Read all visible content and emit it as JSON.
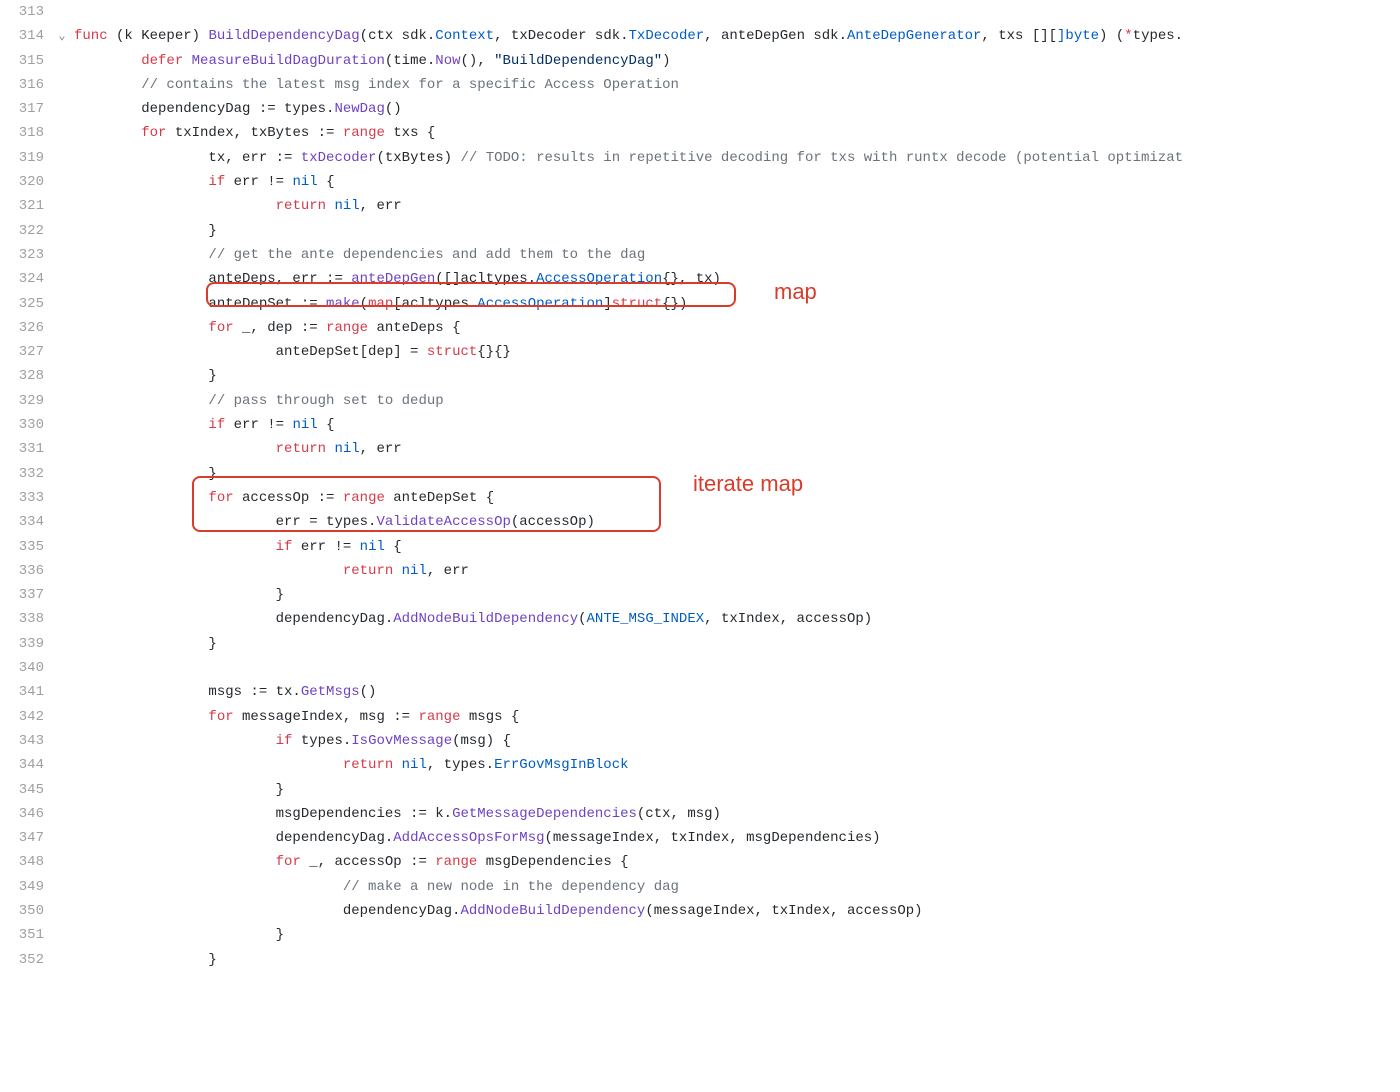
{
  "colors": {
    "keyword": "#d73a49",
    "function": "#6f42c1",
    "type": "#005cc5",
    "string": "#032f62",
    "comment": "#6a737d"
  },
  "annotations": {
    "box1_label": "map",
    "box2_label": "iterate map"
  },
  "lines": [
    {
      "ln": "313",
      "fold": "",
      "tokens": []
    },
    {
      "ln": "314",
      "fold": "⌄",
      "tokens": [
        [
          "kw",
          "func "
        ],
        [
          "id",
          "(k Keeper) "
        ],
        [
          "fn",
          "BuildDependencyDag"
        ],
        [
          "id",
          "(ctx sdk."
        ],
        [
          "ty",
          "Context"
        ],
        [
          "id",
          ", txDecoder sdk."
        ],
        [
          "ty",
          "TxDecoder"
        ],
        [
          "id",
          ", anteDepGen sdk."
        ],
        [
          "ty",
          "AnteDepGenerator"
        ],
        [
          "id",
          ", txs []["
        ],
        [
          "ty",
          "]byte"
        ],
        [
          "id",
          ") ("
        ],
        [
          "kw",
          "*"
        ],
        [
          "id",
          "types."
        ]
      ]
    },
    {
      "ln": "315",
      "fold": "",
      "tokens": [
        [
          "id",
          "        "
        ],
        [
          "kw",
          "defer "
        ],
        [
          "fn",
          "MeasureBuildDagDuration"
        ],
        [
          "id",
          "(time."
        ],
        [
          "fn",
          "Now"
        ],
        [
          "id",
          "(), "
        ],
        [
          "st",
          "\"BuildDependencyDag\""
        ],
        [
          "id",
          ")"
        ]
      ]
    },
    {
      "ln": "316",
      "fold": "",
      "tokens": [
        [
          "id",
          "        "
        ],
        [
          "cm",
          "// contains the latest msg index for a specific Access Operation"
        ]
      ]
    },
    {
      "ln": "317",
      "fold": "",
      "tokens": [
        [
          "id",
          "        dependencyDag := types."
        ],
        [
          "fn",
          "NewDag"
        ],
        [
          "id",
          "()"
        ]
      ]
    },
    {
      "ln": "318",
      "fold": "",
      "tokens": [
        [
          "id",
          "        "
        ],
        [
          "kw",
          "for "
        ],
        [
          "id",
          "txIndex, txBytes := "
        ],
        [
          "kw",
          "range "
        ],
        [
          "id",
          "txs {"
        ]
      ]
    },
    {
      "ln": "319",
      "fold": "",
      "tokens": [
        [
          "id",
          "                tx, err := "
        ],
        [
          "fn",
          "txDecoder"
        ],
        [
          "id",
          "(txBytes) "
        ],
        [
          "cm",
          "// TODO: results in repetitive decoding for txs with runtx decode (potential optimizat"
        ]
      ]
    },
    {
      "ln": "320",
      "fold": "",
      "tokens": [
        [
          "id",
          "                "
        ],
        [
          "kw",
          "if "
        ],
        [
          "id",
          "err != "
        ],
        [
          "ty",
          "nil"
        ],
        [
          "id",
          " {"
        ]
      ]
    },
    {
      "ln": "321",
      "fold": "",
      "tokens": [
        [
          "id",
          "                        "
        ],
        [
          "kw",
          "return "
        ],
        [
          "ty",
          "nil"
        ],
        [
          "id",
          ", err"
        ]
      ]
    },
    {
      "ln": "322",
      "fold": "",
      "tokens": [
        [
          "id",
          "                }"
        ]
      ]
    },
    {
      "ln": "323",
      "fold": "",
      "tokens": [
        [
          "id",
          "                "
        ],
        [
          "cm",
          "// get the ante dependencies and add them to the dag"
        ]
      ]
    },
    {
      "ln": "324",
      "fold": "",
      "tokens": [
        [
          "id",
          "                anteDeps, err := "
        ],
        [
          "fn",
          "anteDepGen"
        ],
        [
          "id",
          "([]acltypes."
        ],
        [
          "ty",
          "AccessOperation"
        ],
        [
          "id",
          "{}, tx)"
        ]
      ]
    },
    {
      "ln": "325",
      "fold": "",
      "tokens": [
        [
          "id",
          "                anteDepSet := "
        ],
        [
          "fn",
          "make"
        ],
        [
          "id",
          "("
        ],
        [
          "kw",
          "map"
        ],
        [
          "id",
          "[acltypes."
        ],
        [
          "ty",
          "AccessOperation"
        ],
        [
          "id",
          "]"
        ],
        [
          "kw",
          "struct"
        ],
        [
          "id",
          "{})"
        ]
      ]
    },
    {
      "ln": "326",
      "fold": "",
      "tokens": [
        [
          "id",
          "                "
        ],
        [
          "kw",
          "for "
        ],
        [
          "id",
          "_, dep := "
        ],
        [
          "kw",
          "range "
        ],
        [
          "id",
          "anteDeps {"
        ]
      ]
    },
    {
      "ln": "327",
      "fold": "",
      "tokens": [
        [
          "id",
          "                        anteDepSet[dep] = "
        ],
        [
          "kw",
          "struct"
        ],
        [
          "id",
          "{}{}"
        ]
      ]
    },
    {
      "ln": "328",
      "fold": "",
      "tokens": [
        [
          "id",
          "                }"
        ]
      ]
    },
    {
      "ln": "329",
      "fold": "",
      "tokens": [
        [
          "id",
          "                "
        ],
        [
          "cm",
          "// pass through set to dedup"
        ]
      ]
    },
    {
      "ln": "330",
      "fold": "",
      "tokens": [
        [
          "id",
          "                "
        ],
        [
          "kw",
          "if "
        ],
        [
          "id",
          "err != "
        ],
        [
          "ty",
          "nil"
        ],
        [
          "id",
          " {"
        ]
      ]
    },
    {
      "ln": "331",
      "fold": "",
      "tokens": [
        [
          "id",
          "                        "
        ],
        [
          "kw",
          "return "
        ],
        [
          "ty",
          "nil"
        ],
        [
          "id",
          ", err"
        ]
      ]
    },
    {
      "ln": "332",
      "fold": "",
      "tokens": [
        [
          "id",
          "                }"
        ]
      ]
    },
    {
      "ln": "333",
      "fold": "",
      "tokens": [
        [
          "id",
          "                "
        ],
        [
          "kw",
          "for "
        ],
        [
          "id",
          "accessOp := "
        ],
        [
          "kw",
          "range "
        ],
        [
          "id",
          "anteDepSet {"
        ]
      ]
    },
    {
      "ln": "334",
      "fold": "",
      "tokens": [
        [
          "id",
          "                        err = types."
        ],
        [
          "fn",
          "ValidateAccessOp"
        ],
        [
          "id",
          "(accessOp)"
        ]
      ]
    },
    {
      "ln": "335",
      "fold": "",
      "tokens": [
        [
          "id",
          "                        "
        ],
        [
          "kw",
          "if "
        ],
        [
          "id",
          "err != "
        ],
        [
          "ty",
          "nil"
        ],
        [
          "id",
          " {"
        ]
      ]
    },
    {
      "ln": "336",
      "fold": "",
      "tokens": [
        [
          "id",
          "                                "
        ],
        [
          "kw",
          "return "
        ],
        [
          "ty",
          "nil"
        ],
        [
          "id",
          ", err"
        ]
      ]
    },
    {
      "ln": "337",
      "fold": "",
      "tokens": [
        [
          "id",
          "                        }"
        ]
      ]
    },
    {
      "ln": "338",
      "fold": "",
      "tokens": [
        [
          "id",
          "                        dependencyDag."
        ],
        [
          "fn",
          "AddNodeBuildDependency"
        ],
        [
          "id",
          "("
        ],
        [
          "ty",
          "ANTE_MSG_INDEX"
        ],
        [
          "id",
          ", txIndex, accessOp)"
        ]
      ]
    },
    {
      "ln": "339",
      "fold": "",
      "tokens": [
        [
          "id",
          "                }"
        ]
      ]
    },
    {
      "ln": "340",
      "fold": "",
      "tokens": []
    },
    {
      "ln": "341",
      "fold": "",
      "tokens": [
        [
          "id",
          "                msgs := tx."
        ],
        [
          "fn",
          "GetMsgs"
        ],
        [
          "id",
          "()"
        ]
      ]
    },
    {
      "ln": "342",
      "fold": "",
      "tokens": [
        [
          "id",
          "                "
        ],
        [
          "kw",
          "for "
        ],
        [
          "id",
          "messageIndex, msg := "
        ],
        [
          "kw",
          "range "
        ],
        [
          "id",
          "msgs {"
        ]
      ]
    },
    {
      "ln": "343",
      "fold": "",
      "tokens": [
        [
          "id",
          "                        "
        ],
        [
          "kw",
          "if "
        ],
        [
          "id",
          "types."
        ],
        [
          "fn",
          "IsGovMessage"
        ],
        [
          "id",
          "(msg) {"
        ]
      ]
    },
    {
      "ln": "344",
      "fold": "",
      "tokens": [
        [
          "id",
          "                                "
        ],
        [
          "kw",
          "return "
        ],
        [
          "ty",
          "nil"
        ],
        [
          "id",
          ", types."
        ],
        [
          "ty",
          "ErrGovMsgInBlock"
        ]
      ]
    },
    {
      "ln": "345",
      "fold": "",
      "tokens": [
        [
          "id",
          "                        }"
        ]
      ]
    },
    {
      "ln": "346",
      "fold": "",
      "tokens": [
        [
          "id",
          "                        msgDependencies := k."
        ],
        [
          "fn",
          "GetMessageDependencies"
        ],
        [
          "id",
          "(ctx, msg)"
        ]
      ]
    },
    {
      "ln": "347",
      "fold": "",
      "tokens": [
        [
          "id",
          "                        dependencyDag."
        ],
        [
          "fn",
          "AddAccessOpsForMsg"
        ],
        [
          "id",
          "(messageIndex, txIndex, msgDependencies)"
        ]
      ]
    },
    {
      "ln": "348",
      "fold": "",
      "tokens": [
        [
          "id",
          "                        "
        ],
        [
          "kw",
          "for "
        ],
        [
          "id",
          "_, accessOp := "
        ],
        [
          "kw",
          "range "
        ],
        [
          "id",
          "msgDependencies {"
        ]
      ]
    },
    {
      "ln": "349",
      "fold": "",
      "tokens": [
        [
          "id",
          "                                "
        ],
        [
          "cm",
          "// make a new node in the dependency dag"
        ]
      ]
    },
    {
      "ln": "350",
      "fold": "",
      "tokens": [
        [
          "id",
          "                                dependencyDag."
        ],
        [
          "fn",
          "AddNodeBuildDependency"
        ],
        [
          "id",
          "(messageIndex, txIndex, accessOp)"
        ]
      ]
    },
    {
      "ln": "351",
      "fold": "",
      "tokens": [
        [
          "id",
          "                        }"
        ]
      ]
    },
    {
      "ln": "352",
      "fold": "",
      "tokens": [
        [
          "id",
          "                }"
        ]
      ]
    }
  ]
}
